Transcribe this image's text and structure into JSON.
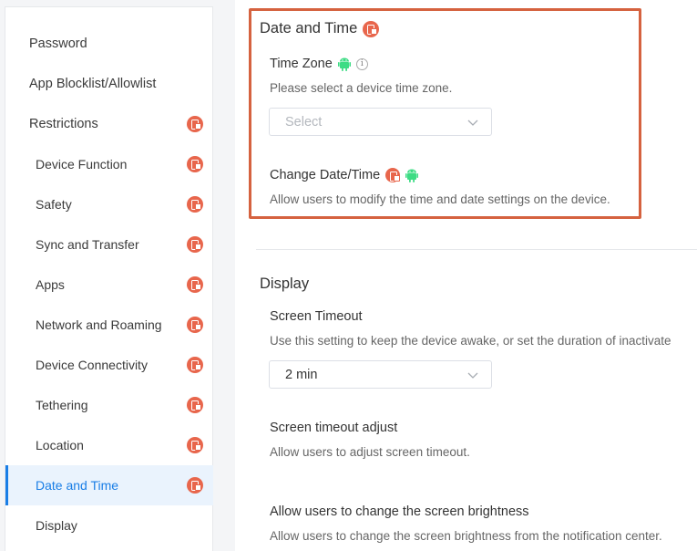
{
  "sidebar": {
    "items": [
      {
        "label": "Password",
        "level": "top",
        "ios": false,
        "active": false
      },
      {
        "label": "App Blocklist/Allowlist",
        "level": "top",
        "ios": false,
        "active": false
      },
      {
        "label": "Restrictions",
        "level": "top",
        "ios": true,
        "active": false
      },
      {
        "label": "Device Function",
        "level": "sub",
        "ios": true,
        "active": false
      },
      {
        "label": "Safety",
        "level": "sub",
        "ios": true,
        "active": false
      },
      {
        "label": "Sync and Transfer",
        "level": "sub",
        "ios": true,
        "active": false
      },
      {
        "label": "Apps",
        "level": "sub",
        "ios": true,
        "active": false
      },
      {
        "label": "Network and Roaming",
        "level": "sub",
        "ios": true,
        "active": false
      },
      {
        "label": "Device Connectivity",
        "level": "sub",
        "ios": true,
        "active": false
      },
      {
        "label": "Tethering",
        "level": "sub",
        "ios": true,
        "active": false
      },
      {
        "label": "Location",
        "level": "sub",
        "ios": true,
        "active": false
      },
      {
        "label": "Date and Time",
        "level": "sub",
        "ios": true,
        "active": true
      },
      {
        "label": "Display",
        "level": "sub",
        "ios": false,
        "active": false
      }
    ]
  },
  "date_time": {
    "title": "Date and Time",
    "time_zone": {
      "title": "Time Zone",
      "desc": "Please select a device time zone.",
      "placeholder": "Select"
    },
    "change": {
      "title": "Change Date/Time",
      "desc": "Allow users to modify the time and date settings on the device."
    }
  },
  "display": {
    "title": "Display",
    "screen_timeout": {
      "title": "Screen Timeout",
      "desc": "Use this setting to keep the device awake, or set the duration of inactivate",
      "value": "2 min"
    },
    "timeout_adjust": {
      "title": "Screen timeout adjust",
      "desc": "Allow users to adjust screen timeout."
    },
    "brightness": {
      "title": "Allow users to change the screen brightness",
      "desc": "Allow users to change the screen brightness from the notification center."
    }
  },
  "colors": {
    "accent": "#1a7ee6",
    "ios_badge": "#e8664c",
    "android": "#3ddc84",
    "highlight_border": "#d5623f"
  },
  "icons": {
    "ios": "ios-platform-icon",
    "android": "android-platform-icon",
    "info": "info-icon",
    "chevron": "chevron-down-icon"
  }
}
